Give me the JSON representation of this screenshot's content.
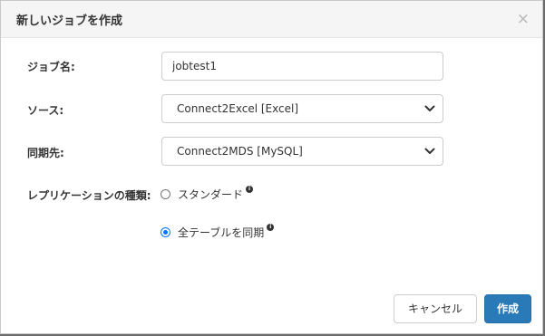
{
  "dialog": {
    "title": "新しいジョブを作成",
    "close_symbol": "×"
  },
  "form": {
    "job_name": {
      "label": "ジョブ名:",
      "value": "jobtest1"
    },
    "source": {
      "label": "ソース:",
      "selected": "Connect2Excel [Excel]"
    },
    "destination": {
      "label": "同期先:",
      "selected": "Connect2MDS [MySQL]"
    },
    "replication_type": {
      "label": "レプリケーションの種類:",
      "options": [
        {
          "label": "スタンダード",
          "checked": false
        },
        {
          "label": "全テーブルを同期",
          "checked": true
        }
      ],
      "info_symbol": "i"
    }
  },
  "buttons": {
    "cancel_label": "キャンセル",
    "create_label": "作成"
  },
  "colors": {
    "primary": "#2a7ab8",
    "radio_checked": "#0075ff",
    "header_bg": "#f5f5f5"
  },
  "icons": [
    "close-icon",
    "chevron-down-icon",
    "info-icon"
  ]
}
